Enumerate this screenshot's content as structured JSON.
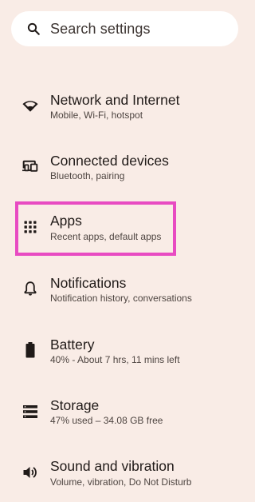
{
  "search": {
    "placeholder": "Search settings",
    "icon": "search-icon"
  },
  "settings": {
    "items": [
      {
        "id": "network",
        "icon": "wifi-icon",
        "title": "Network and Internet",
        "subtitle": "Mobile, Wi-Fi, hotspot"
      },
      {
        "id": "connected",
        "icon": "connected-devices-icon",
        "title": "Connected devices",
        "subtitle": "Bluetooth, pairing"
      },
      {
        "id": "apps",
        "icon": "apps-grid-icon",
        "title": "Apps",
        "subtitle": "Recent apps, default apps"
      },
      {
        "id": "notifications",
        "icon": "bell-icon",
        "title": "Notifications",
        "subtitle": "Notification history, conversations"
      },
      {
        "id": "battery",
        "icon": "battery-icon",
        "title": "Battery",
        "subtitle": "40% - About 7 hrs, 11 mins left"
      },
      {
        "id": "storage",
        "icon": "storage-icon",
        "title": "Storage",
        "subtitle": "47% used – 34.08 GB free"
      },
      {
        "id": "sound",
        "icon": "speaker-icon",
        "title": "Sound and vibration",
        "subtitle": "Volume, vibration, Do Not Disturb"
      }
    ]
  },
  "colors": {
    "background": "#f9ece6",
    "highlight": "#e84bc2",
    "search_bg": "#ffffff"
  }
}
